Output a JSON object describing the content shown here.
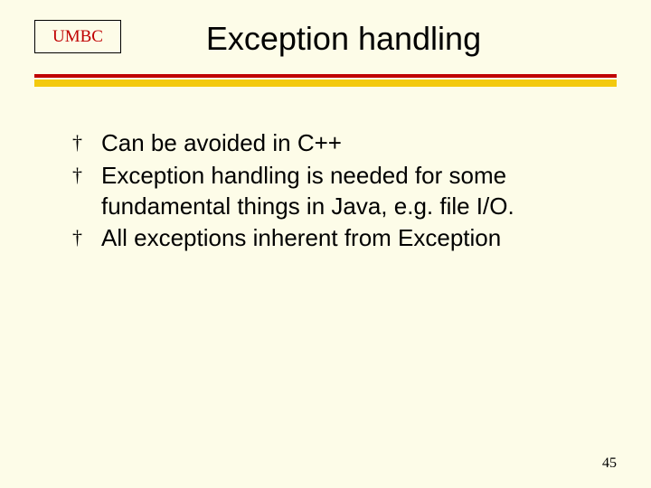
{
  "header": {
    "logo": "UMBC",
    "title": "Exception handling"
  },
  "bullets": [
    "Can be avoided in C++",
    "Exception handling is needed for some fundamental things in Java, e.g. file I/O.",
    "All exceptions inherent from Exception"
  ],
  "bullet_glyph": "†",
  "page_number": "45"
}
